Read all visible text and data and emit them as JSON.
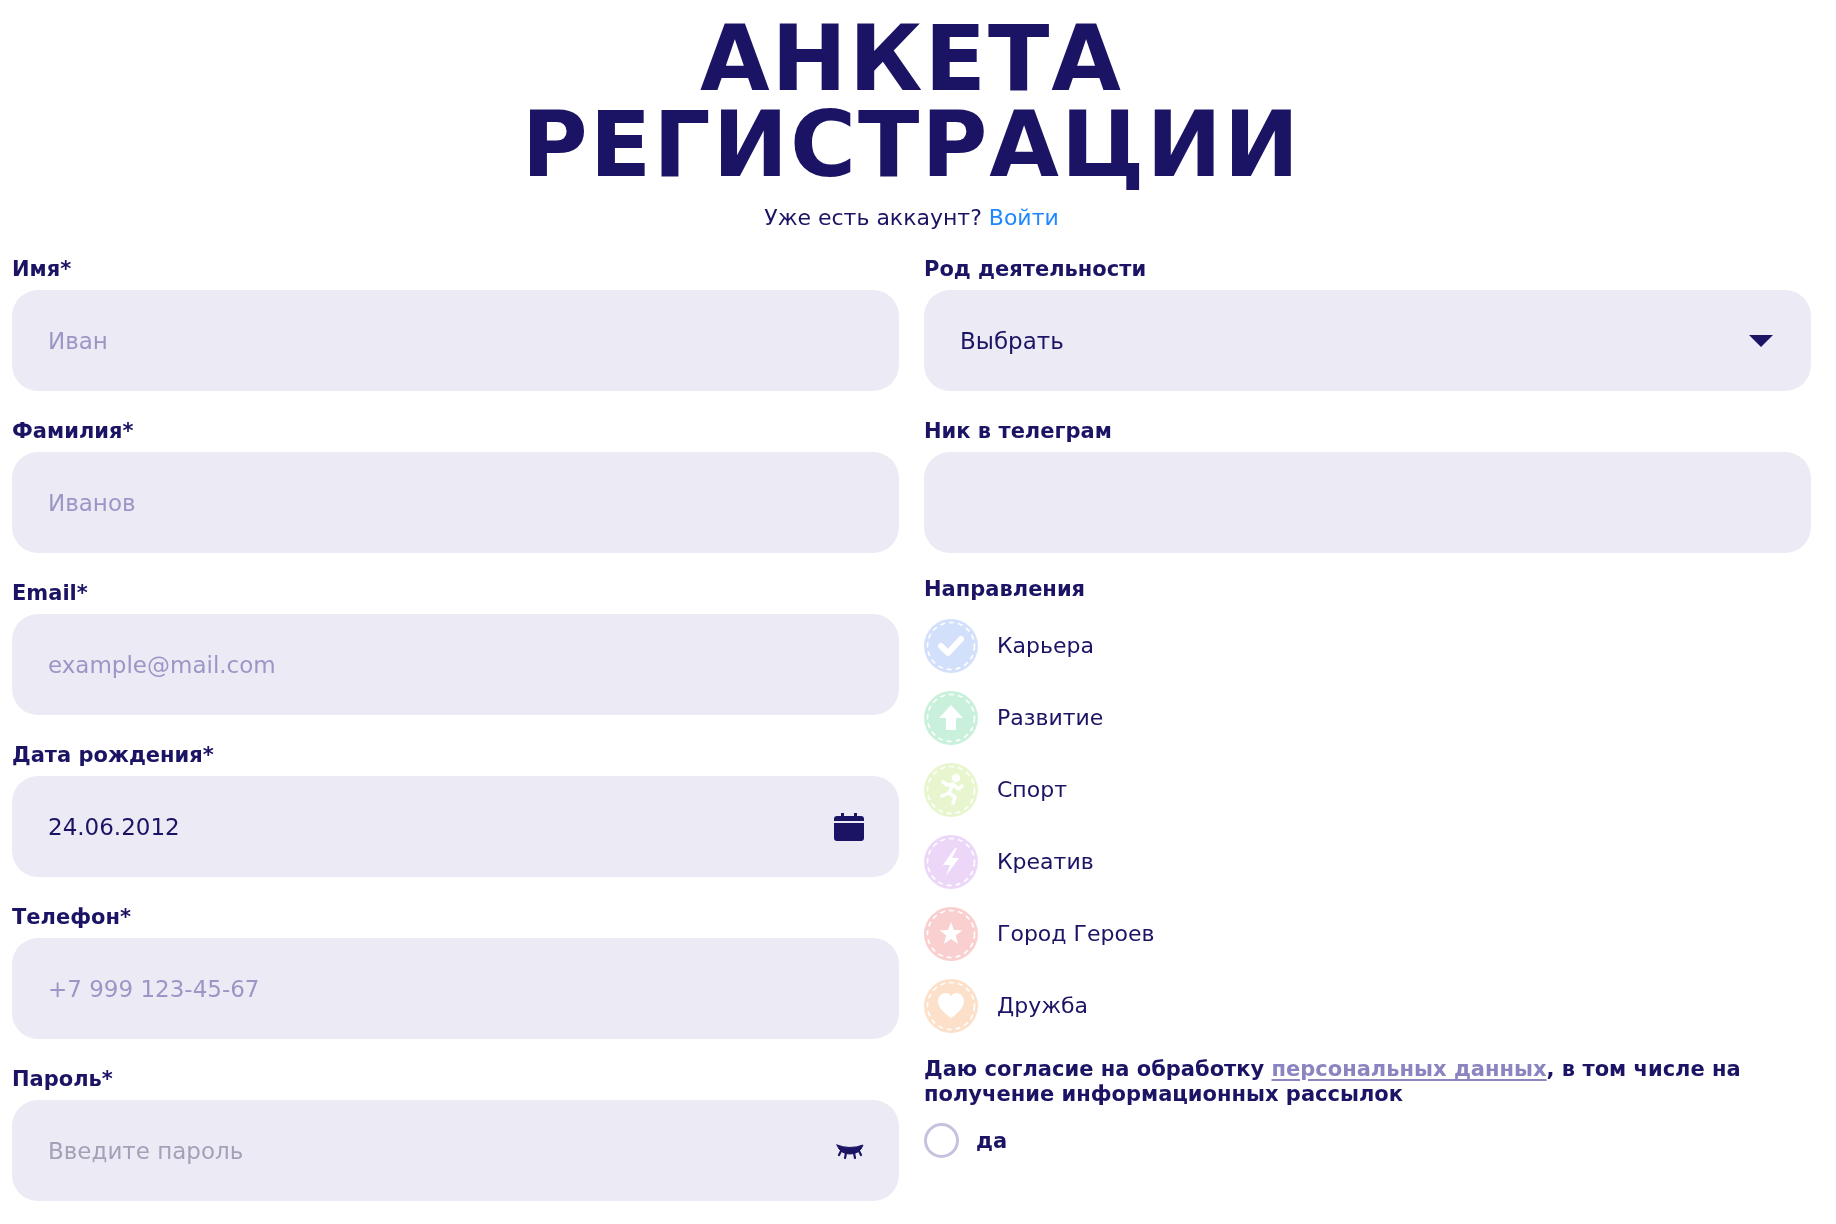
{
  "title": "АНКЕТА РЕГИСТРАЦИИ",
  "login_prompt": {
    "text": "Уже есть аккаунт?",
    "link": "Войти"
  },
  "left_fields": [
    {
      "kind": "text",
      "label": "Имя*",
      "placeholder": "Иван"
    },
    {
      "kind": "text",
      "label": "Фамилия*",
      "placeholder": "Иванов"
    },
    {
      "kind": "text",
      "label": "Email*",
      "placeholder": "example@mail.com"
    },
    {
      "kind": "date",
      "label": "Дата рождения*",
      "value": "24.06.2012"
    },
    {
      "kind": "text",
      "label": "Телефон*",
      "placeholder": "+7 999 123-45-67"
    },
    {
      "kind": "password",
      "label": "Пароль*",
      "placeholder": "Введите пароль"
    }
  ],
  "right_fields": [
    {
      "kind": "select",
      "label": "Род деятельности",
      "value": "Выбрать"
    },
    {
      "kind": "text",
      "label": "Ник в телеграм"
    }
  ],
  "directions": {
    "label": "Направления",
    "items": [
      {
        "name": "Карьера",
        "color": "#d3e0fb",
        "checked": false
      },
      {
        "name": "Развитие",
        "color": "#c8f0da",
        "checked": false
      },
      {
        "name": "Спорт",
        "color": "#e8f6cf",
        "checked": false
      },
      {
        "name": "Креатив",
        "color": "#ecd7f9",
        "checked": false
      },
      {
        "name": "Город Героев",
        "color": "#f9cfd0",
        "checked": false
      },
      {
        "name": "Дружба",
        "color": "#fde0c9",
        "checked": false
      }
    ]
  },
  "consent": {
    "text_before": "Даю согласие на обработку",
    "link": "персональных данных",
    "text_after": ", в том числе на получение информационных рассылок",
    "option": {
      "label": "да",
      "checked": false
    }
  }
}
